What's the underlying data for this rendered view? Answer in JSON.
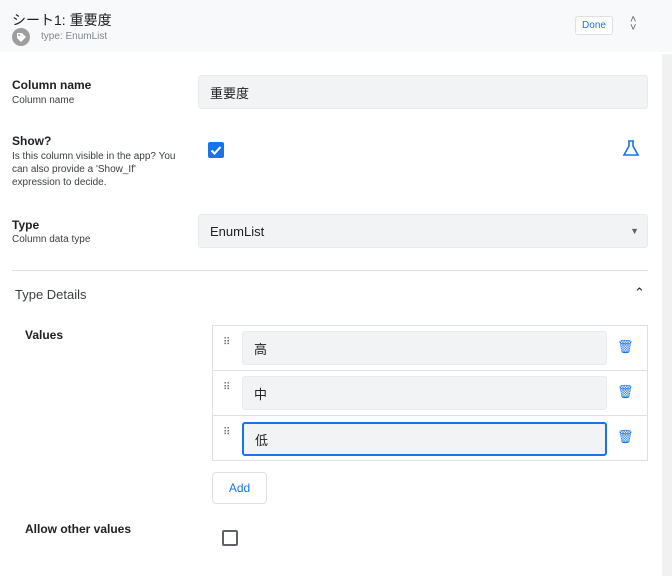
{
  "header": {
    "title": "シート1: 重要度",
    "type_label": "type: EnumList",
    "done_label": "Done"
  },
  "column_name": {
    "label": "Column name",
    "description": "Column name",
    "value": "重要度"
  },
  "show": {
    "label": "Show?",
    "description": "Is this column visible in the app? You can also provide a 'Show_If' expression to decide.",
    "checked": true
  },
  "type": {
    "label": "Type",
    "description": "Column data type",
    "value": "EnumList"
  },
  "type_details": {
    "title": "Type Details",
    "values_label": "Values",
    "values": [
      "高",
      "中",
      "低"
    ],
    "add_label": "Add",
    "allow_other_label": "Allow other values",
    "allow_other_checked": false
  },
  "colors": {
    "accent": "#1a73e8"
  }
}
